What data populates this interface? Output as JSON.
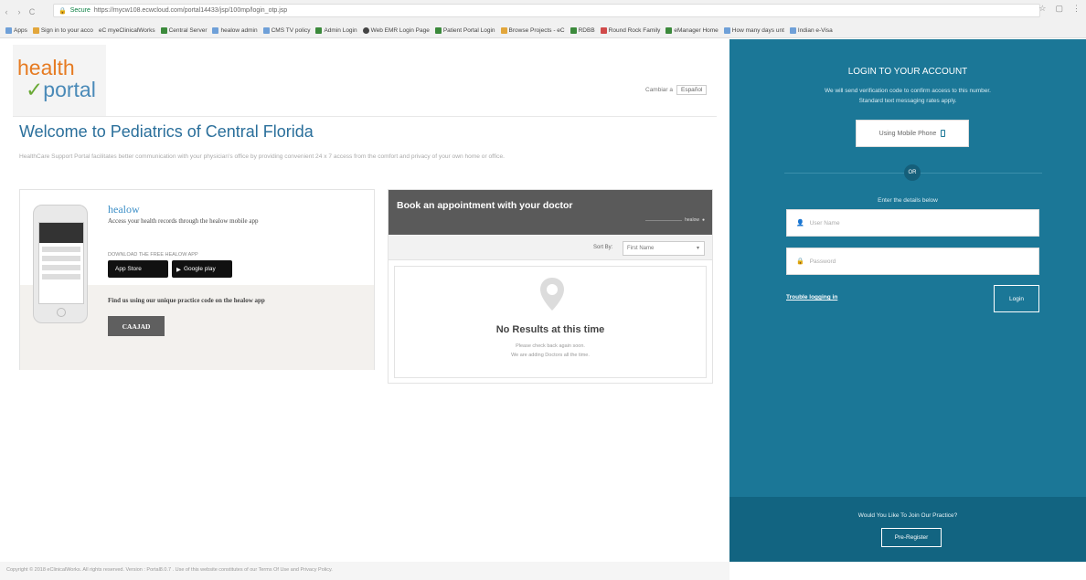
{
  "browser": {
    "secure_label": "Secure",
    "url": "https://mycw108.ecwcloud.com/portal14433/jsp/100mp/login_otp.jsp",
    "bookmarks": [
      "Apps",
      "Sign in to your acco",
      "eC myeClinicalWorks",
      "Central Server",
      "healow admin",
      "CMS TV policy",
      "Admin Login",
      "Web EMR Login Page",
      "Patient Portal Login",
      "Browse Projects - eC",
      "RDBB",
      "Round Rock Family",
      "eManager Home",
      "How many days unt",
      "Indian e-Visa"
    ]
  },
  "header": {
    "logo_line1": "health",
    "logo_line2": "portal",
    "lang_label": "Cambiar a",
    "lang_button": "Español"
  },
  "main": {
    "title": "Welcome to Pediatrics of Central Florida",
    "description": "HealthCare Support Portal facilitates better communication with your physician's office by providing convenient 24 x 7 access from the comfort and privacy of your own home or office."
  },
  "healow": {
    "brand": "healow",
    "tagline": "Access your health records through the healow mobile app",
    "download_label": "DOWNLOAD THE FREE HEALOW APP",
    "appstore": "App Store",
    "googleplay": "Google play",
    "find_text": "Find us using our unique practice code on the healow app",
    "code": "CAAJAD"
  },
  "booking": {
    "title": "Book an appointment with your doctor",
    "powered": "healow",
    "sort_label": "Sort By:",
    "sort_value": "First Name",
    "no_results": "No Results at this time",
    "sub1": "Please check back again soon.",
    "sub2": "We are adding Doctors all the time."
  },
  "login": {
    "title": "LOGIN TO YOUR ACCOUNT",
    "msg1": "We will send verification code to confirm access to this number.",
    "msg2": "Standard text messaging rates apply.",
    "mobile_button": "Using Mobile Phone",
    "or": "OR",
    "enter": "Enter the details below",
    "username_placeholder": "User Name",
    "password_placeholder": "Password",
    "trouble": "Trouble logging in",
    "login_button": "Login",
    "join": "Would You Like To Join Our Practice?",
    "preregister": "Pre-Register"
  },
  "footer": {
    "text": "Copyright © 2018 eClinicalWorks. All rights reserved. Version : Portal8.0.7 . Use of this website constitutes of our Terms Of Use and Privacy Policy."
  },
  "colors": {
    "accent": "#1b7797",
    "title_blue": "#2a6f9b",
    "logo_orange": "#e67b22"
  }
}
